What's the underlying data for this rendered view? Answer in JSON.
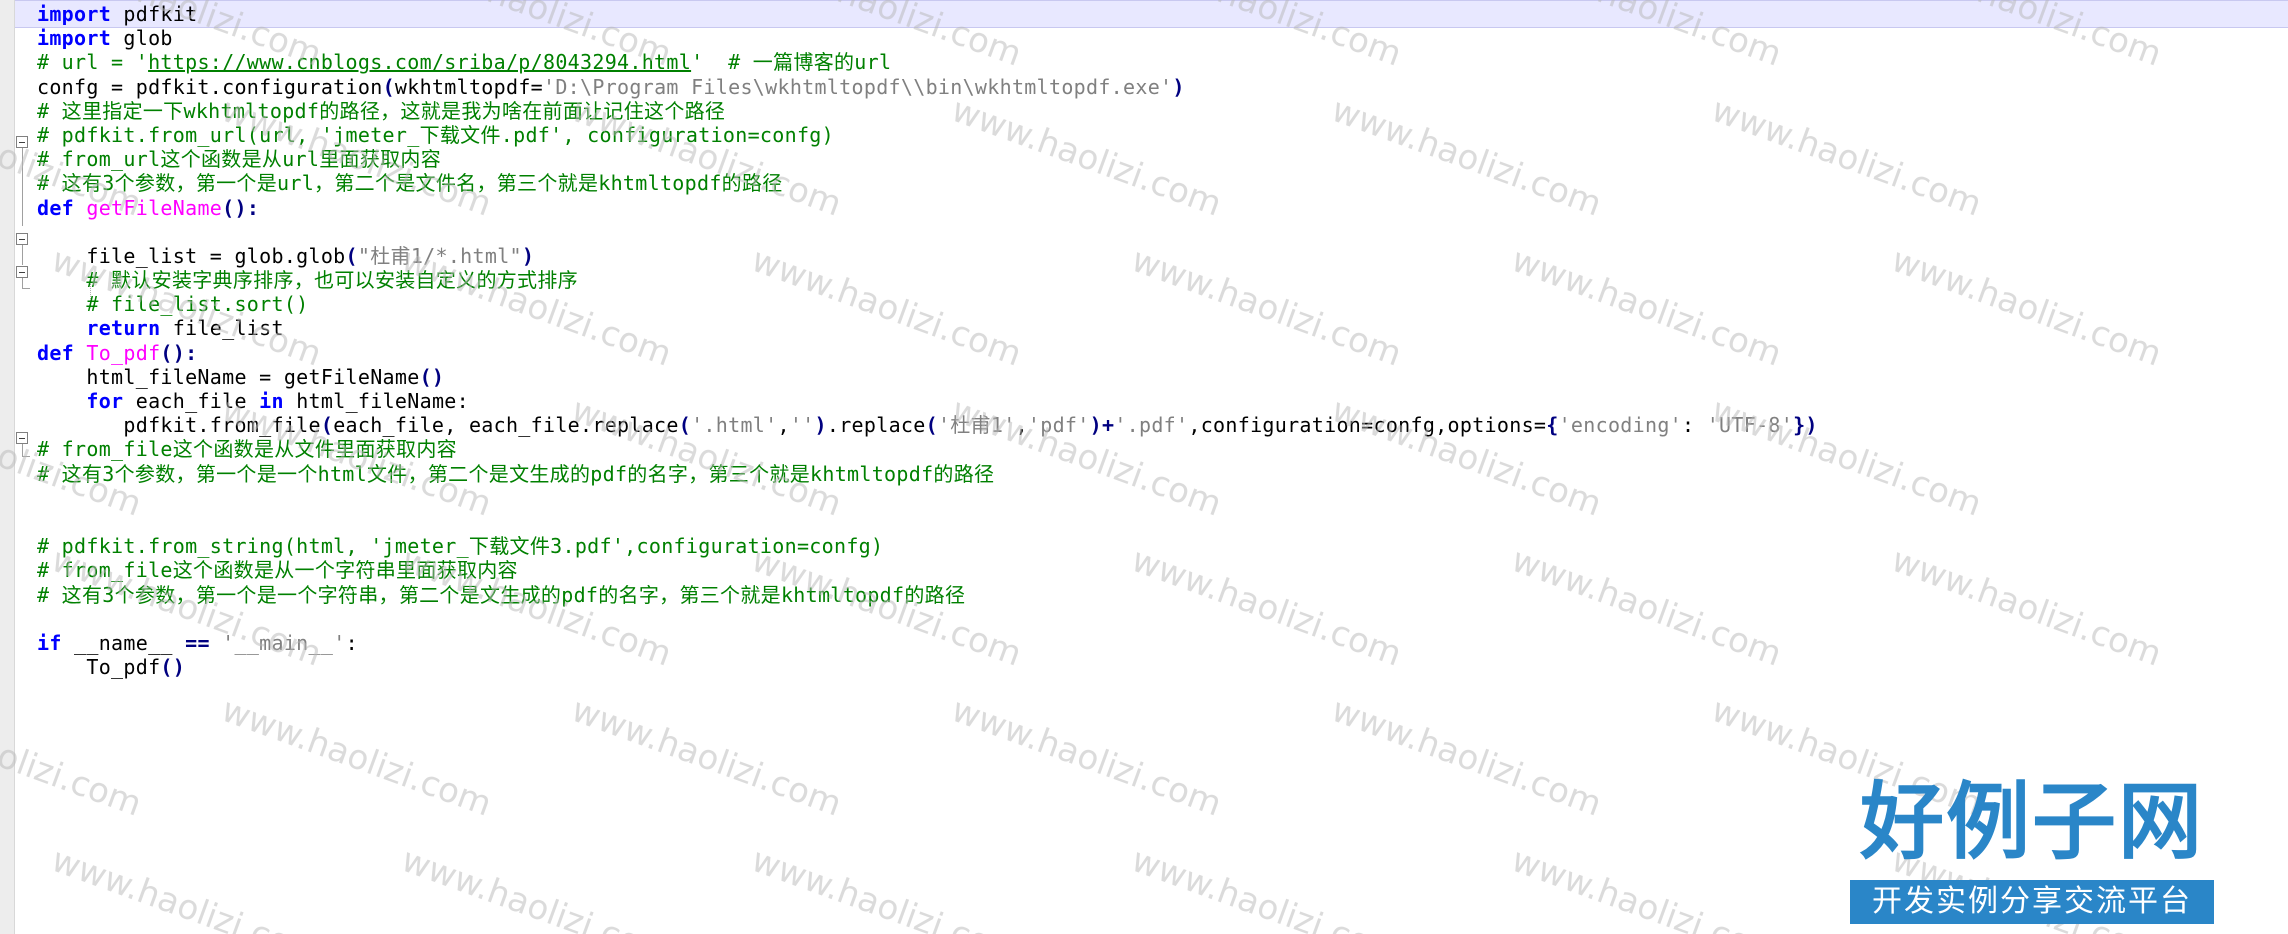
{
  "editor": {
    "lines": [
      [
        {
          "t": "import",
          "c": "kw"
        },
        {
          "t": " pdfkit"
        }
      ],
      [
        {
          "t": "import",
          "c": "kw"
        },
        {
          "t": " glob"
        }
      ],
      [
        {
          "t": "# url = '",
          "c": "cm"
        },
        {
          "t": "https://www.cnblogs.com/sriba/p/8043294.html",
          "c": "cm ul"
        },
        {
          "t": "'  # 一篇博客的url",
          "c": "cm"
        }
      ],
      [
        {
          "t": "confg = pdfkit.configuration"
        },
        {
          "t": "(",
          "c": "op"
        },
        {
          "t": "wkhtmltopdf="
        },
        {
          "t": "'D:\\Program Files\\wkhtmltopdf\\\\bin\\wkhtmltopdf.exe'",
          "c": "st"
        },
        {
          "t": ")",
          "c": "op"
        }
      ],
      [
        {
          "t": "# 这里指定一下wkhtmltopdf的路径，这就是我为啥在前面让记住这个路径",
          "c": "cm"
        }
      ],
      [
        {
          "t": "# pdfkit.from_url(url, 'jmeter_下载文件.pdf', configuration=confg)",
          "c": "cm"
        }
      ],
      [
        {
          "t": "# from_url这个函数是从url里面获取内容",
          "c": "cm"
        }
      ],
      [
        {
          "t": "# 这有3个参数，第一个是url，第二个是文件名，第三个就是khtmltopdf的路径",
          "c": "cm"
        }
      ],
      [
        {
          "t": "def",
          "c": "kw"
        },
        {
          "t": " "
        },
        {
          "t": "getFileName",
          "c": "fn"
        },
        {
          "t": "():",
          "c": "op"
        }
      ],
      [
        {
          "t": ""
        }
      ],
      [
        {
          "t": "    file_list = glob.glob"
        },
        {
          "t": "(",
          "c": "op"
        },
        {
          "t": "\"杜甫1/*.html\"",
          "c": "st"
        },
        {
          "t": ")",
          "c": "op"
        }
      ],
      [
        {
          "t": "    # 默认安装字典序排序，也可以安装自定义的方式排序",
          "c": "cm"
        }
      ],
      [
        {
          "t": "    # file_list.sort()",
          "c": "cm"
        }
      ],
      [
        {
          "t": "    "
        },
        {
          "t": "return",
          "c": "kw"
        },
        {
          "t": " file_list"
        }
      ],
      [
        {
          "t": "def",
          "c": "kw"
        },
        {
          "t": " "
        },
        {
          "t": "To_pdf",
          "c": "fn"
        },
        {
          "t": "():",
          "c": "op"
        }
      ],
      [
        {
          "t": "    html_fileName = getFileName"
        },
        {
          "t": "()",
          "c": "op"
        }
      ],
      [
        {
          "t": "    "
        },
        {
          "t": "for",
          "c": "kw"
        },
        {
          "t": " each_file "
        },
        {
          "t": "in",
          "c": "kw"
        },
        {
          "t": " html_fileName:"
        }
      ],
      [
        {
          "t": "       pdfkit.from_file"
        },
        {
          "t": "(",
          "c": "op"
        },
        {
          "t": "each_file, each_file.replace"
        },
        {
          "t": "(",
          "c": "op"
        },
        {
          "t": "'.html'",
          "c": "st"
        },
        {
          "t": ","
        },
        {
          "t": "''",
          "c": "st"
        },
        {
          "t": ")",
          "c": "op"
        },
        {
          "t": ".replace"
        },
        {
          "t": "(",
          "c": "op"
        },
        {
          "t": "'杜甫1'",
          "c": "st"
        },
        {
          "t": ","
        },
        {
          "t": "'pdf'",
          "c": "st"
        },
        {
          "t": ")+",
          "c": "op"
        },
        {
          "t": "'.pdf'",
          "c": "st"
        },
        {
          "t": ",configuration=confg,options="
        },
        {
          "t": "{",
          "c": "op"
        },
        {
          "t": "'encoding'",
          "c": "st"
        },
        {
          "t": ": "
        },
        {
          "t": "'UTF-8'",
          "c": "st"
        },
        {
          "t": "})",
          "c": "op"
        }
      ],
      [
        {
          "t": "# from_file这个函数是从文件里面获取内容",
          "c": "cm"
        }
      ],
      [
        {
          "t": "# 这有3个参数，第一个是一个html文件，第二个是文生成的pdf的名字，第三个就是khtmltopdf的路径",
          "c": "cm"
        }
      ],
      [
        {
          "t": ""
        }
      ],
      [
        {
          "t": ""
        }
      ],
      [
        {
          "t": "# pdfkit.from_string(html, 'jmeter_下载文件3.pdf',configuration=confg)",
          "c": "cm"
        }
      ],
      [
        {
          "t": "# from_file这个函数是从一个字符串里面获取内容",
          "c": "cm"
        }
      ],
      [
        {
          "t": "# 这有3个参数，第一个是一个字符串，第二个是文生成的pdf的名字，第三个就是khtmltopdf的路径",
          "c": "cm"
        }
      ],
      [
        {
          "t": ""
        }
      ],
      [
        {
          "t": "if",
          "c": "kw"
        },
        {
          "t": " __name__ "
        },
        {
          "t": "==",
          "c": "op"
        },
        {
          "t": " "
        },
        {
          "t": "'__main__'",
          "c": "st"
        },
        {
          "t": ":"
        }
      ],
      [
        {
          "t": "    To_pdf"
        },
        {
          "t": "()",
          "c": "op"
        }
      ]
    ]
  },
  "watermark": {
    "text": "www.haolizi.com"
  },
  "logo": {
    "title": "好例子网",
    "subtitle": "开发实例分享交流平台"
  },
  "colors": {
    "keyword": "#0000ff",
    "function_name": "#ff00ff",
    "comment": "#008000",
    "string": "#808080",
    "logo_blue": "#2a86c8"
  }
}
